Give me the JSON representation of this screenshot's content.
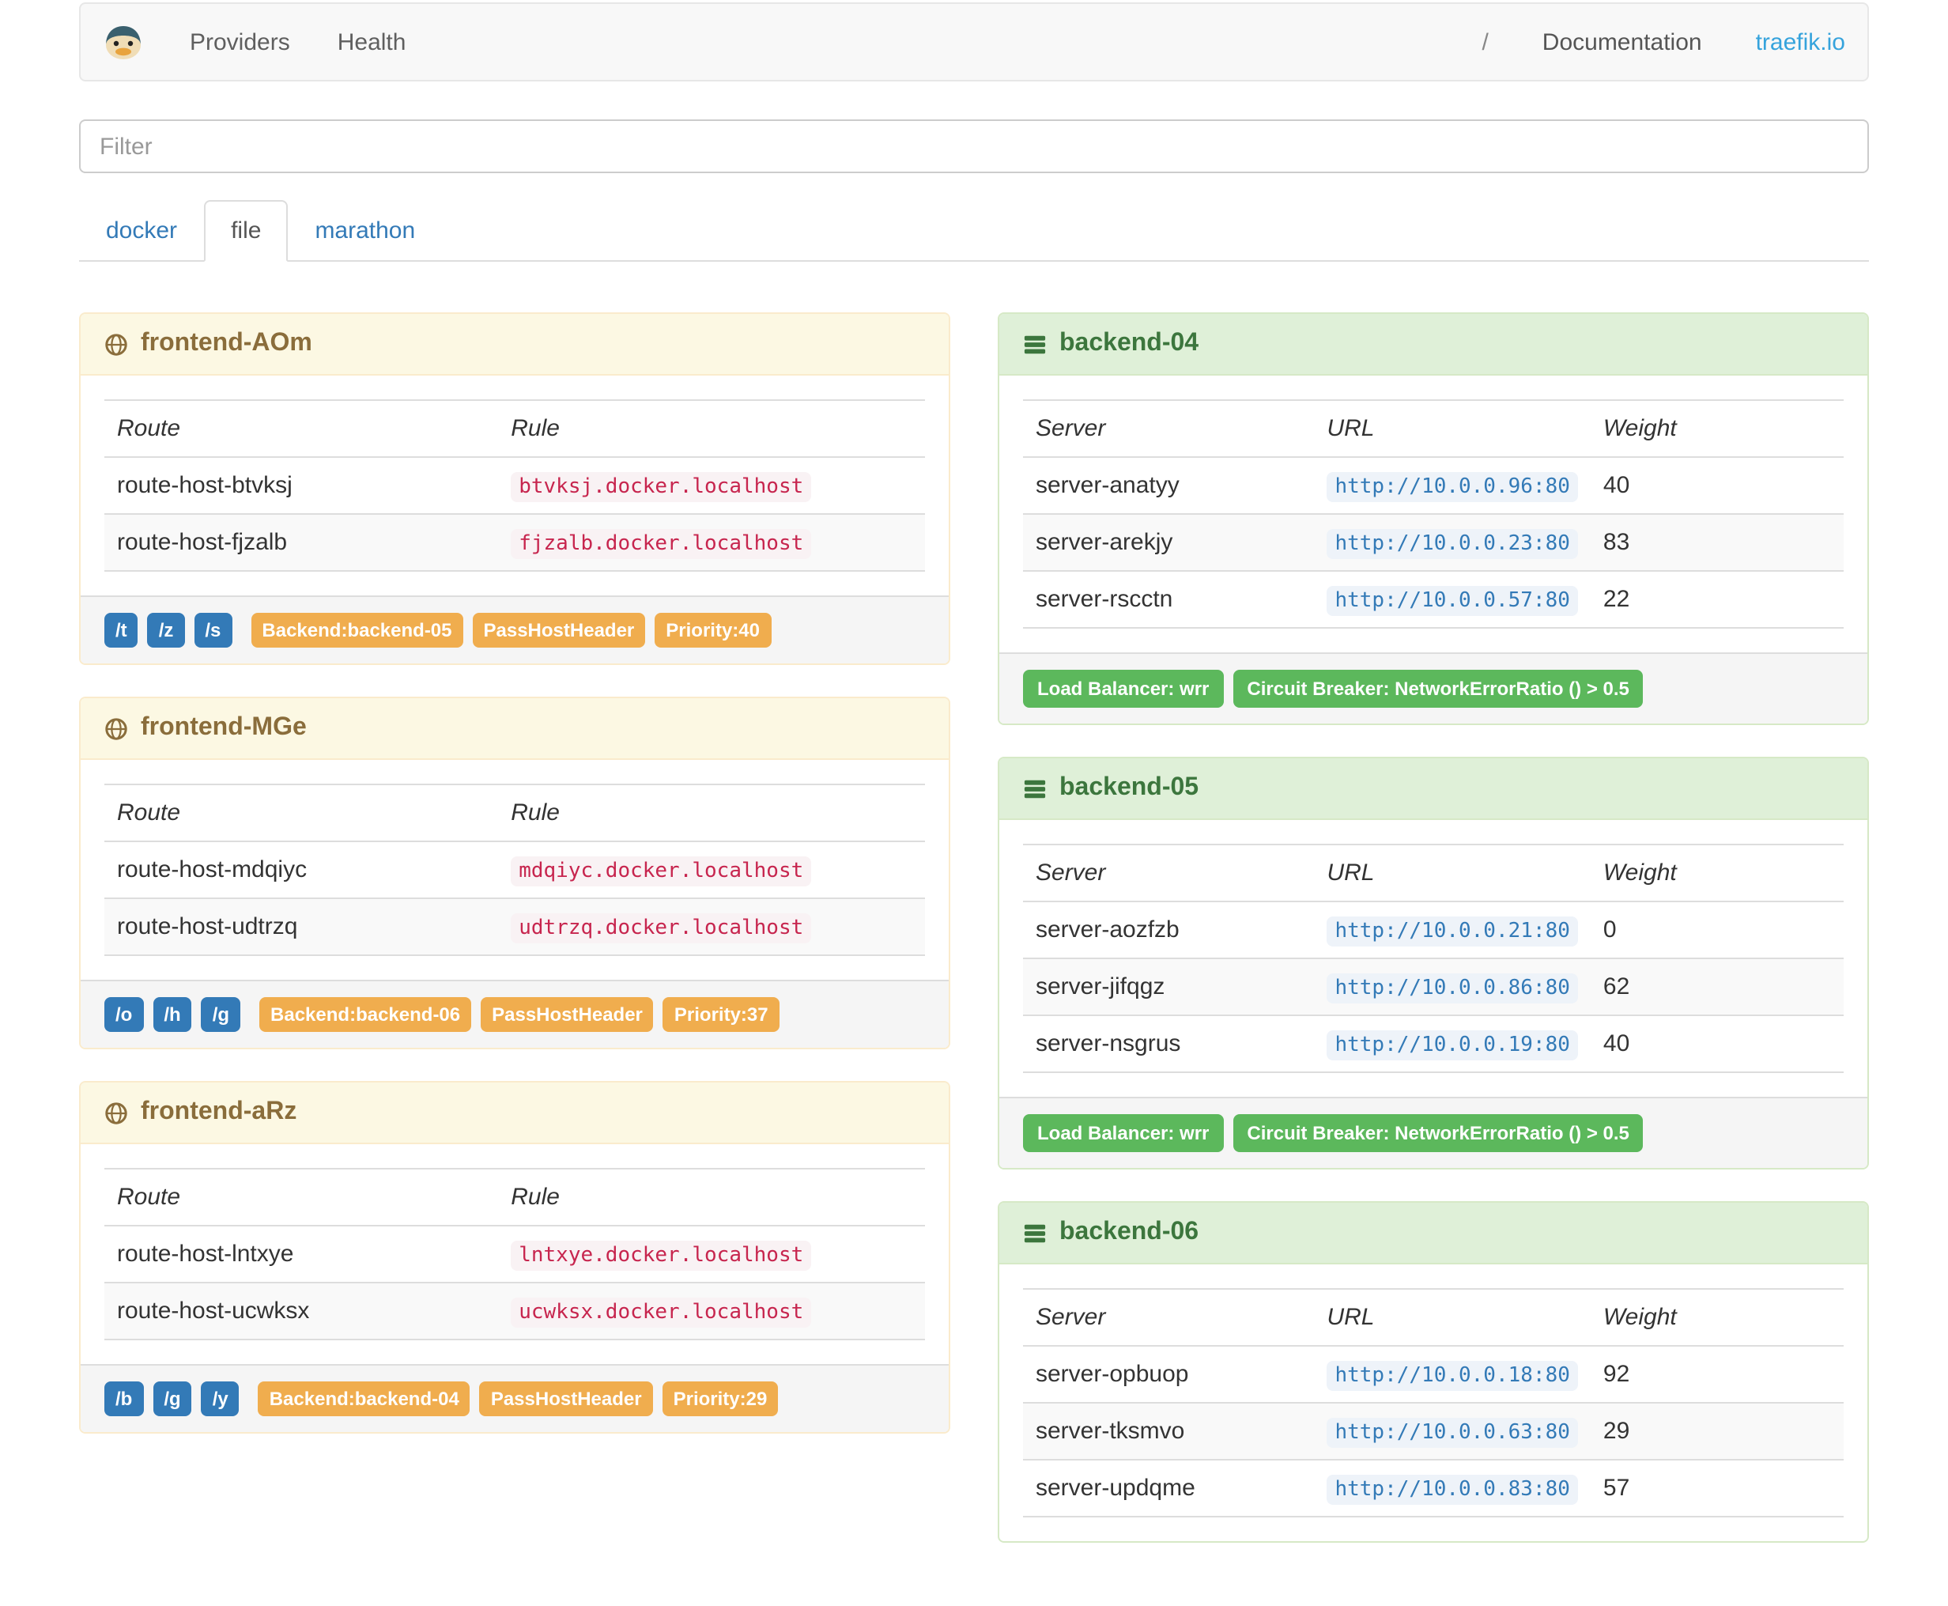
{
  "theme": {
    "link_blue": "#337ab7",
    "brand_blue": "#36a3dc",
    "primary_badge": "#337ab7",
    "warning_badge": "#f0ad4e",
    "success_badge": "#5cb85c",
    "frontend_header_bg": "#fcf8e3",
    "frontend_header_text": "#8a6d3b",
    "backend_header_bg": "#dff0d8",
    "backend_header_text": "#3c763d",
    "rule_code_text": "#c7254e",
    "url_code_text": "#337ab7"
  },
  "navbar": {
    "logo_icon": "traefik-logo",
    "links": [
      {
        "label": "Providers"
      },
      {
        "label": "Health"
      }
    ],
    "right_links": [
      {
        "label": "/"
      },
      {
        "label": "Documentation"
      },
      {
        "label": "traefik.io"
      }
    ]
  },
  "filter": {
    "placeholder": "Filter"
  },
  "tabs": [
    {
      "label": "docker",
      "active": false
    },
    {
      "label": "file",
      "active": true
    },
    {
      "label": "marathon",
      "active": false
    }
  ],
  "frontends": {
    "icon": "globe-icon",
    "columns": {
      "route": "Route",
      "rule": "Rule"
    },
    "items": [
      {
        "title": "frontend-AOm",
        "routes": [
          {
            "route": "route-host-btvksj",
            "rule": "btvksj.docker.localhost"
          },
          {
            "route": "route-host-fjzalb",
            "rule": "fjzalb.docker.localhost"
          }
        ],
        "entrypoints": [
          "/t",
          "/z",
          "/s"
        ],
        "tags": [
          "Backend:backend-05",
          "PassHostHeader",
          "Priority:40"
        ]
      },
      {
        "title": "frontend-MGe",
        "routes": [
          {
            "route": "route-host-mdqiyc",
            "rule": "mdqiyc.docker.localhost"
          },
          {
            "route": "route-host-udtrzq",
            "rule": "udtrzq.docker.localhost"
          }
        ],
        "entrypoints": [
          "/o",
          "/h",
          "/g"
        ],
        "tags": [
          "Backend:backend-06",
          "PassHostHeader",
          "Priority:37"
        ]
      },
      {
        "title": "frontend-aRz",
        "routes": [
          {
            "route": "route-host-lntxye",
            "rule": "lntxye.docker.localhost"
          },
          {
            "route": "route-host-ucwksx",
            "rule": "ucwksx.docker.localhost"
          }
        ],
        "entrypoints": [
          "/b",
          "/g",
          "/y"
        ],
        "tags": [
          "Backend:backend-04",
          "PassHostHeader",
          "Priority:29"
        ]
      }
    ]
  },
  "backends": {
    "icon": "servers-icon",
    "columns": {
      "server": "Server",
      "url": "URL",
      "weight": "Weight"
    },
    "items": [
      {
        "title": "backend-04",
        "servers": [
          {
            "server": "server-anatyy",
            "url": "http://10.0.0.96:80",
            "weight": "40"
          },
          {
            "server": "server-arekjy",
            "url": "http://10.0.0.23:80",
            "weight": "83"
          },
          {
            "server": "server-rscctn",
            "url": "http://10.0.0.57:80",
            "weight": "22"
          }
        ],
        "badges": [
          "Load Balancer: wrr",
          "Circuit Breaker: NetworkErrorRatio () > 0.5"
        ]
      },
      {
        "title": "backend-05",
        "servers": [
          {
            "server": "server-aozfzb",
            "url": "http://10.0.0.21:80",
            "weight": "0"
          },
          {
            "server": "server-jifqgz",
            "url": "http://10.0.0.86:80",
            "weight": "62"
          },
          {
            "server": "server-nsgrus",
            "url": "http://10.0.0.19:80",
            "weight": "40"
          }
        ],
        "badges": [
          "Load Balancer: wrr",
          "Circuit Breaker: NetworkErrorRatio () > 0.5"
        ]
      },
      {
        "title": "backend-06",
        "servers": [
          {
            "server": "server-opbuop",
            "url": "http://10.0.0.18:80",
            "weight": "92"
          },
          {
            "server": "server-tksmvo",
            "url": "http://10.0.0.63:80",
            "weight": "29"
          },
          {
            "server": "server-updqme",
            "url": "http://10.0.0.83:80",
            "weight": "57"
          }
        ]
      }
    ]
  }
}
